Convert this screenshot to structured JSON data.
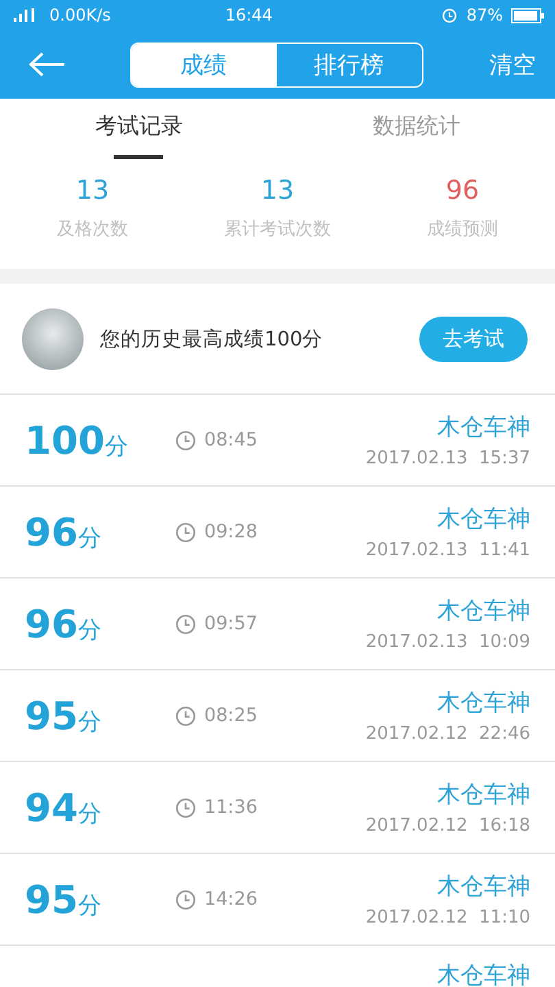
{
  "status_bar": {
    "network_speed": "0.00K/s",
    "time": "16:44",
    "battery": "87%"
  },
  "header": {
    "segments": [
      {
        "label": "成绩",
        "selected": true
      },
      {
        "label": "排行榜",
        "selected": false
      }
    ],
    "action": "清空"
  },
  "tabs": [
    {
      "label": "考试记录",
      "selected": true
    },
    {
      "label": "数据统计",
      "selected": false
    }
  ],
  "stats": [
    {
      "value": "13",
      "label": "及格次数",
      "kind": "normal"
    },
    {
      "value": "13",
      "label": "累计考试次数",
      "kind": "normal"
    },
    {
      "value": "96",
      "label": "成绩预测",
      "kind": "highlight"
    }
  ],
  "best": {
    "text": "您的历史最高成绩100分",
    "button": "去考试"
  },
  "records": [
    {
      "score": "100",
      "unit": "分",
      "duration": "08:45",
      "name": "木仓车神",
      "date": "2017.02.13  15:37"
    },
    {
      "score": "96",
      "unit": "分",
      "duration": "09:28",
      "name": "木仓车神",
      "date": "2017.02.13  11:41"
    },
    {
      "score": "96",
      "unit": "分",
      "duration": "09:57",
      "name": "木仓车神",
      "date": "2017.02.13  10:09"
    },
    {
      "score": "95",
      "unit": "分",
      "duration": "08:25",
      "name": "木仓车神",
      "date": "2017.02.12  22:46"
    },
    {
      "score": "94",
      "unit": "分",
      "duration": "11:36",
      "name": "木仓车神",
      "date": "2017.02.12  16:18"
    },
    {
      "score": "95",
      "unit": "分",
      "duration": "14:26",
      "name": "木仓车神",
      "date": "2017.02.12  11:10"
    },
    {
      "name": "木仓车神"
    }
  ]
}
